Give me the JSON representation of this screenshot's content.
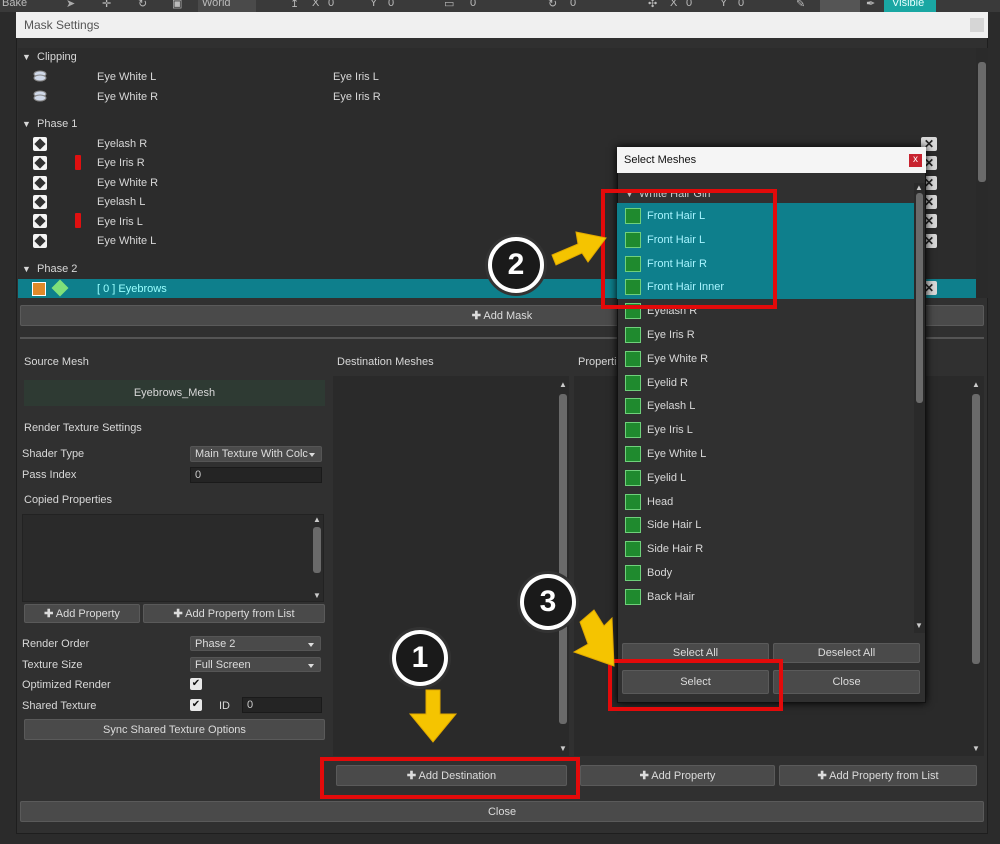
{
  "toolbar": {
    "bake": "Bake",
    "world": "World",
    "x1": "X",
    "v1": "0",
    "y1": "Y",
    "v2": "0",
    "v3": "0",
    "v4": "0",
    "x2": "X",
    "v5": "0",
    "y2": "Y",
    "v6": "0",
    "visible": "Visible"
  },
  "window": {
    "title": "Mask Settings"
  },
  "clipping": {
    "label": "Clipping",
    "rows": [
      {
        "name": "Eye White L",
        "target": "Eye Iris L"
      },
      {
        "name": "Eye White R",
        "target": "Eye Iris R"
      }
    ]
  },
  "phase1": {
    "label": "Phase 1",
    "rows": [
      "Eyelash R",
      "Eye Iris R",
      "Eye White R",
      "Eyelash L",
      "Eye Iris L",
      "Eye White L"
    ]
  },
  "phase2": {
    "label": "Phase 2",
    "selected": "[ 0 ] Eyebrows"
  },
  "add_mask": "Add Mask",
  "source": {
    "header": "Source Mesh",
    "mesh": "Eyebrows_Mesh",
    "render_texture_settings": "Render Texture Settings",
    "shader_type_label": "Shader Type",
    "shader_type_value": "Main Texture With Colc",
    "pass_index_label": "Pass Index",
    "pass_index_value": "0",
    "copied_properties": "Copied Properties",
    "add_property": "Add Property",
    "add_property_from_list": "Add Property from List",
    "render_order_label": "Render Order",
    "render_order_value": "Phase 2",
    "texture_size_label": "Texture Size",
    "texture_size_value": "Full Screen",
    "optimized_render_label": "Optimized Render",
    "shared_texture_label": "Shared Texture",
    "id_label": "ID",
    "id_value": "0",
    "sync": "Sync Shared Texture Options"
  },
  "destination": {
    "header": "Destination Meshes",
    "add_destination": "Add Destination"
  },
  "properties": {
    "header": "Properti",
    "add_property": "Add Property",
    "add_property_from_list": "Add Property from List"
  },
  "close": "Close",
  "dialog": {
    "title": "Select Meshes",
    "close_x": "x",
    "group": "White Hair Girl",
    "selected": [
      "Front Hair L",
      "Front Hair L",
      "Front Hair R",
      "Front Hair Inner"
    ],
    "items": [
      "Eyelash R",
      "Eye Iris R",
      "Eye White R",
      "Eyelid R",
      "Eyelash L",
      "Eye Iris L",
      "Eye White L",
      "Eyelid L",
      "Head",
      "Side Hair L",
      "Side Hair R",
      "Body",
      "Back Hair"
    ],
    "select_all": "Select All",
    "deselect_all": "Deselect All",
    "select": "Select",
    "close": "Close"
  },
  "callouts": {
    "one": "1",
    "two": "2",
    "three": "3"
  },
  "colors": {
    "selection": "#0e7f8c",
    "highlight_box": "#e30a0a",
    "arrow": "#f5c400",
    "mesh_icon": "#1f8a2e"
  }
}
